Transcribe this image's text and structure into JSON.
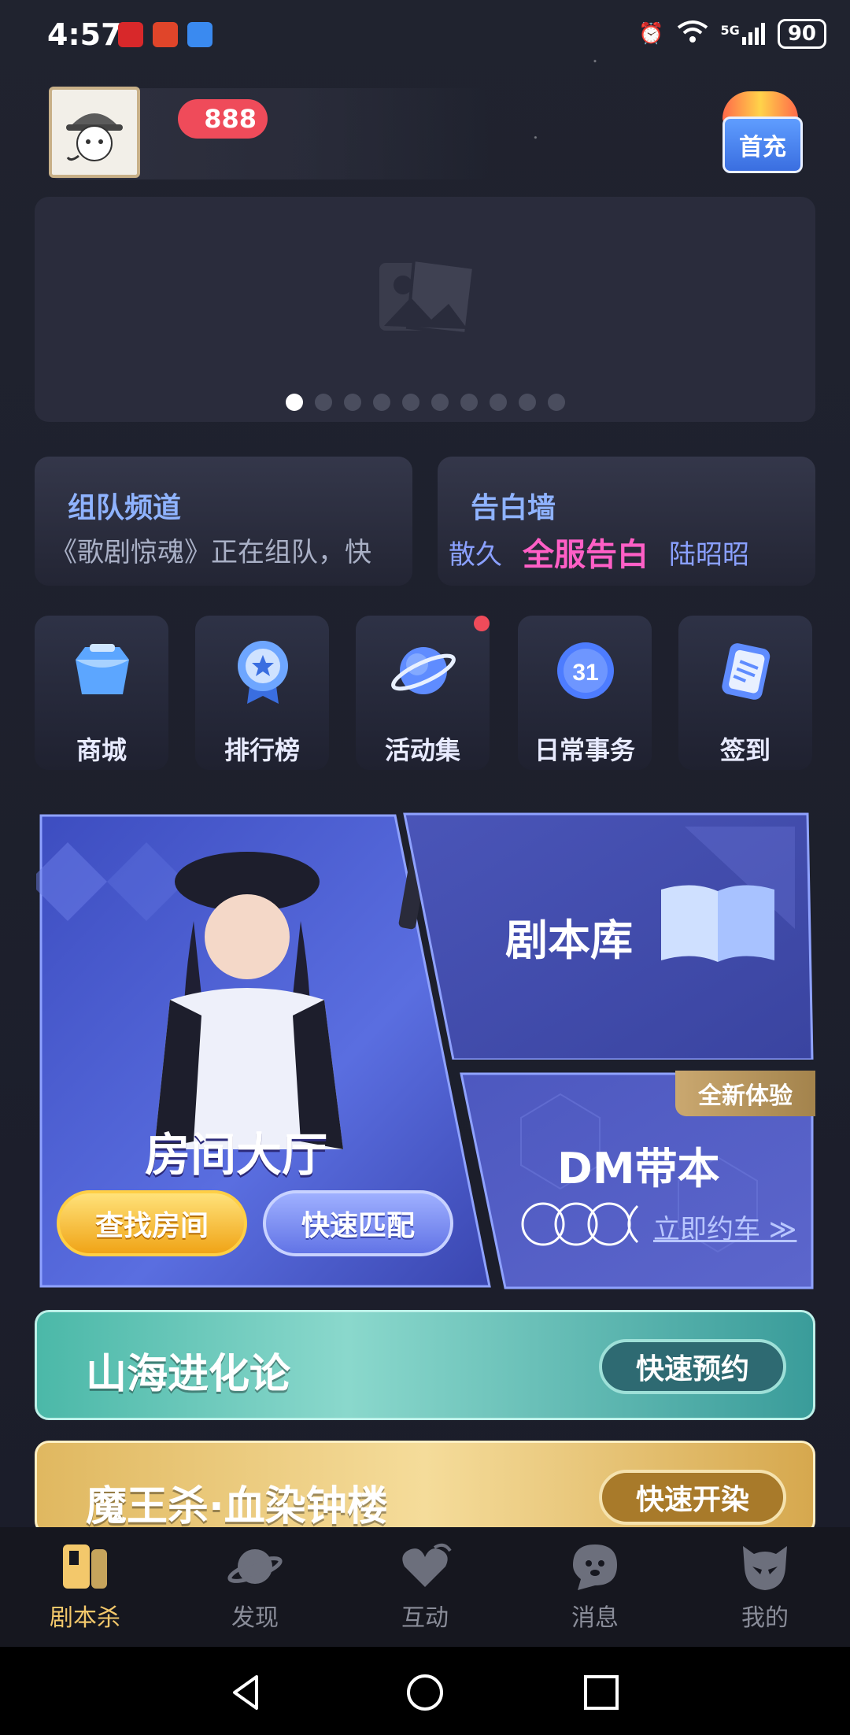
{
  "status_bar": {
    "time": "4:57",
    "network": "5G",
    "battery": "90"
  },
  "header": {
    "coin_count": "888",
    "first_charge_label": "首充"
  },
  "banner": {
    "page_count": 10,
    "active_index": 0
  },
  "channels": {
    "team": {
      "title": "组队频道",
      "subtitle": "《歌剧惊魂》正在组队，快"
    },
    "confession": {
      "title": "告白墙",
      "from": "散久",
      "tag": "全服告白",
      "to": "陆昭昭"
    }
  },
  "quick_entries": [
    {
      "label": "商城",
      "icon": "shop-icon"
    },
    {
      "label": "排行榜",
      "icon": "ranking-medal-icon"
    },
    {
      "label": "活动集",
      "icon": "planet-icon"
    },
    {
      "label": "日常事务",
      "icon": "calendar-31-icon"
    },
    {
      "label": "签到",
      "icon": "checkin-clipboard-icon"
    }
  ],
  "hall_card": {
    "title": "房间大厅",
    "find_button": "查找房间",
    "match_button": "快速匹配"
  },
  "library_card": {
    "title": "剧本库"
  },
  "dm_card": {
    "title": "DM带本",
    "tag": "全新体验",
    "link": "立即约车 ≫"
  },
  "events": [
    {
      "title": "山海进化论",
      "button": "快速预约"
    },
    {
      "title": "魔王杀·血染钟楼",
      "button": "快速开染"
    }
  ],
  "tabs": [
    {
      "label": "剧本杀",
      "icon": "script-book-icon",
      "active": true
    },
    {
      "label": "发现",
      "icon": "planet-icon",
      "active": false
    },
    {
      "label": "互动",
      "icon": "heart-chat-icon",
      "active": false
    },
    {
      "label": "消息",
      "icon": "message-bubble-icon",
      "active": false
    },
    {
      "label": "我的",
      "icon": "mask-face-icon",
      "active": false
    }
  ],
  "colors": {
    "accent_gold": "#f3c86b",
    "badge_red": "#ef4b5a",
    "link_blue": "#8fb3ff"
  }
}
